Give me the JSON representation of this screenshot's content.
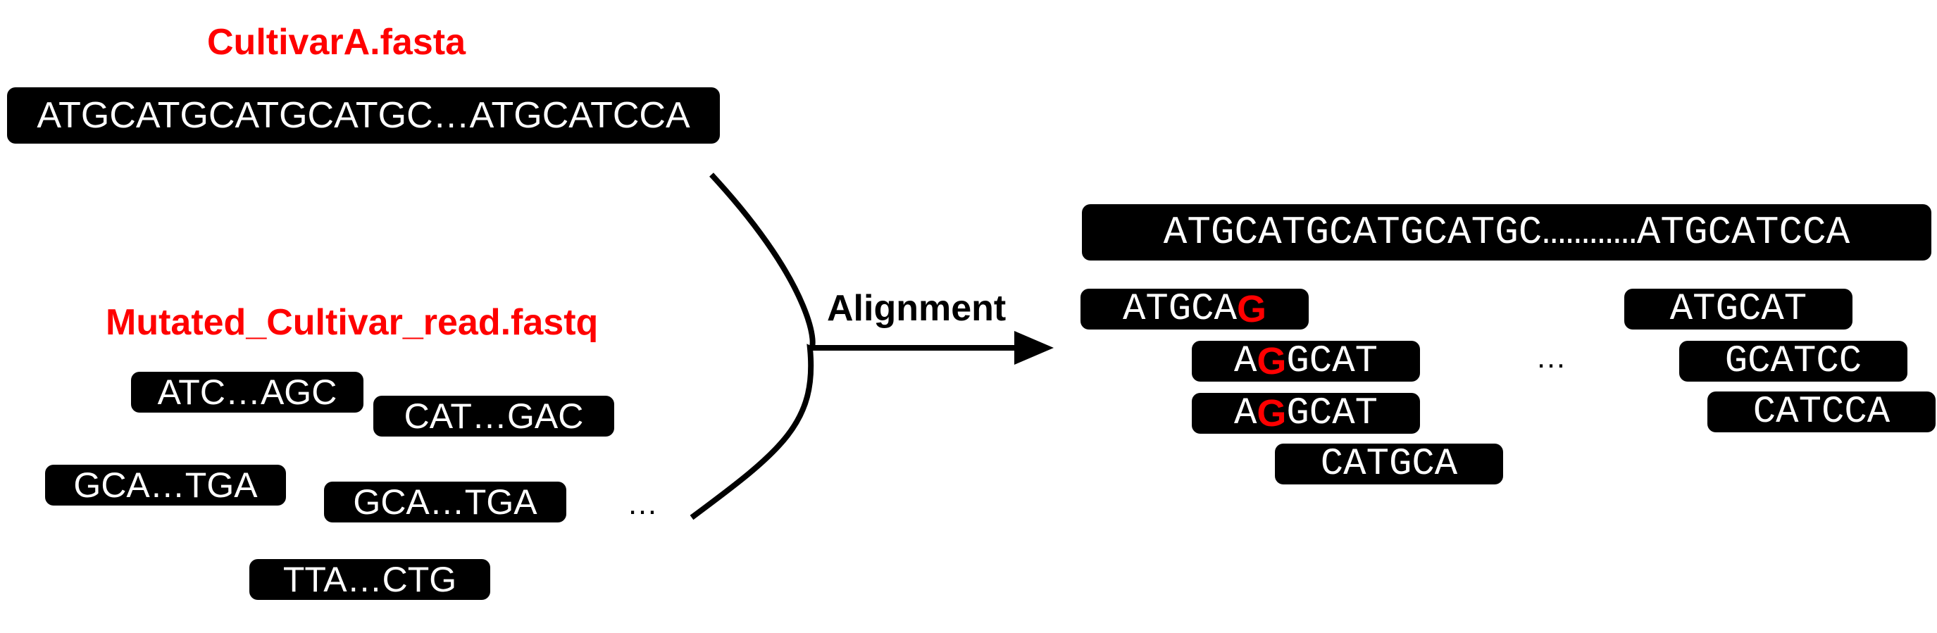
{
  "reference": {
    "filename": "CultivarA.fasta",
    "sequence": "ATGCATGCATGCATGC…ATGCATCCA"
  },
  "reads": {
    "filename": "Mutated_Cultivar_read.fastq",
    "items": [
      "ATC…AGC",
      "CAT…GAC",
      "GCA…TGA",
      "GCA…TGA",
      "TTA…CTG"
    ],
    "ellipsis": "…"
  },
  "arrow": {
    "label": "Alignment"
  },
  "alignment": {
    "reference": "ATGCATGCATGCATGC…………ATGCATCCA",
    "left_reads": [
      {
        "pre": "ATGCA",
        "mut": "G",
        "post": ""
      },
      {
        "pre": "A",
        "mut": "G",
        "post": "GCAT"
      },
      {
        "pre": "A",
        "mut": "G",
        "post": "GCAT"
      },
      {
        "pre": "CATGCA",
        "mut": "",
        "post": ""
      }
    ],
    "ellipsis": "…",
    "right_reads": [
      "ATGCAT",
      "GCATCC",
      "CATCCA"
    ]
  },
  "colors": {
    "highlight": "#ff0000",
    "box_fill": "#000000",
    "box_text": "#ffffff"
  }
}
